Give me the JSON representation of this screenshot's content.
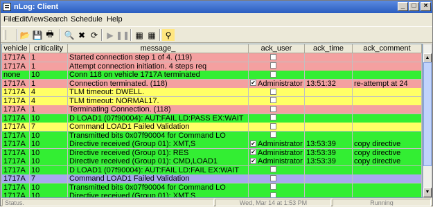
{
  "window": {
    "title": "nLog: Client"
  },
  "menu": [
    "File",
    "Edit",
    "View",
    "Search",
    "Schedule",
    "Help"
  ],
  "toolbar": [
    "open-icon",
    "save-icon",
    "print-icon",
    "print-preview-icon",
    "delete-icon",
    "refresh-icon",
    "play-icon",
    "pause-icon",
    "export-icon",
    "import-icon",
    "filter-icon"
  ],
  "columns": [
    "vehicle",
    "criticality",
    "message_",
    "ack_user",
    "ack_time",
    "ack_comment"
  ],
  "colors": {
    "red": "#f4a0a0",
    "green": "#33ee33",
    "yellow": "#ffff66",
    "blue": "#a8a8f0"
  },
  "rows": [
    {
      "vehicle": "1717A",
      "criticality": "1",
      "message": "Started connection step 1 of 4. (119)",
      "checked": false,
      "ack_user": "",
      "ack_time": "",
      "ack_comment": "",
      "color": "red"
    },
    {
      "vehicle": "1717A",
      "criticality": "1",
      "message": "Attempt connection initiation. 4 steps req",
      "checked": false,
      "ack_user": "",
      "ack_time": "",
      "ack_comment": "",
      "color": "red"
    },
    {
      "vehicle": "none",
      "criticality": "10",
      "message": "Conn 118 on vehicle 1717A terminated",
      "checked": false,
      "ack_user": "",
      "ack_time": "",
      "ack_comment": "",
      "color": "green"
    },
    {
      "vehicle": "1717A",
      "criticality": "1",
      "message": "Connection terminated. (118)",
      "checked": true,
      "ack_user": "Administrator",
      "ack_time": "13:51:32",
      "ack_comment": "re-attempt at 24",
      "color": "red"
    },
    {
      "vehicle": "1717A",
      "criticality": "4",
      "message": "TLM timeout: DWELL.",
      "checked": false,
      "ack_user": "",
      "ack_time": "",
      "ack_comment": "",
      "color": "yellow"
    },
    {
      "vehicle": "1717A",
      "criticality": "4",
      "message": "TLM timeout: NORMAL17.",
      "checked": false,
      "ack_user": "",
      "ack_time": "",
      "ack_comment": "",
      "color": "yellow"
    },
    {
      "vehicle": "1717A",
      "criticality": "1",
      "message": "Terminating Connection. (118)",
      "checked": false,
      "ack_user": "",
      "ack_time": "",
      "ack_comment": "",
      "color": "red"
    },
    {
      "vehicle": "1717A",
      "criticality": "10",
      "message": "D    LOAD1 (07f90004): AUT:FAIL LD:PASS EX:WAIT",
      "checked": false,
      "ack_user": "",
      "ack_time": "",
      "ack_comment": "",
      "color": "green"
    },
    {
      "vehicle": "1717A",
      "criticality": "7",
      "message": "Command LOAD1 Failed Validation",
      "checked": false,
      "ack_user": "",
      "ack_time": "",
      "ack_comment": "",
      "color": "yellow"
    },
    {
      "vehicle": "1717A",
      "criticality": "10",
      "message": "Transmitted bits 0x07f90004 for Command LO",
      "checked": false,
      "ack_user": "",
      "ack_time": "",
      "ack_comment": "",
      "color": "green"
    },
    {
      "vehicle": "1717A",
      "criticality": "10",
      "message": "Directive received (Group 01): XMT,S",
      "checked": true,
      "ack_user": "Administrator",
      "ack_time": "13:53:39",
      "ack_comment": "copy directive",
      "color": "green"
    },
    {
      "vehicle": "1717A",
      "criticality": "10",
      "message": "Directive received (Group 01): RES",
      "checked": true,
      "ack_user": "Administrator",
      "ack_time": "13:53:39",
      "ack_comment": "copy directive",
      "color": "green"
    },
    {
      "vehicle": "1717A",
      "criticality": "10",
      "message": "Directive received (Group 01): CMD,LOAD1",
      "checked": true,
      "ack_user": "Administrator",
      "ack_time": "13:53:39",
      "ack_comment": "copy directive",
      "color": "green"
    },
    {
      "vehicle": "1717A",
      "criticality": "10",
      "message": "D    LOAD1 (07f90004): AUT:FAIL LD:FAIL EX:WAIT",
      "checked": false,
      "ack_user": "",
      "ack_time": "",
      "ack_comment": "",
      "color": "green"
    },
    {
      "vehicle": "1717A",
      "criticality": "7",
      "message": "Command LOAD1 Failed Validation",
      "checked": false,
      "ack_user": "",
      "ack_time": "",
      "ack_comment": "",
      "color": "blue"
    },
    {
      "vehicle": "1717A",
      "criticality": "10",
      "message": "Transmitted bits 0x07f90004 for Command LO",
      "checked": false,
      "ack_user": "",
      "ack_time": "",
      "ack_comment": "",
      "color": "green"
    },
    {
      "vehicle": "1717A",
      "criticality": "10",
      "message": "Directive received (Group 01): XMT,S",
      "checked": false,
      "ack_user": "",
      "ack_time": "",
      "ack_comment": "",
      "color": "green"
    }
  ],
  "status": {
    "left": "Status.",
    "middle": "Wed, Mar 14 at 1:53 PM",
    "right": "Running"
  }
}
